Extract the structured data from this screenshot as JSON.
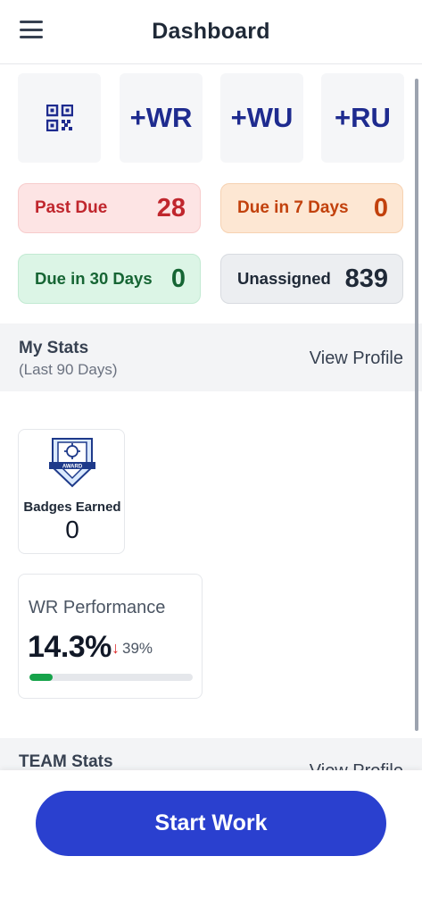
{
  "header": {
    "title": "Dashboard",
    "menu_icon": "hamburger-menu-icon"
  },
  "quick_actions": [
    {
      "icon": "qr-code-icon",
      "label": ""
    },
    {
      "label": "+WR"
    },
    {
      "label": "+WU"
    },
    {
      "label": "+RU"
    }
  ],
  "summary": {
    "past_due": {
      "label": "Past Due",
      "count": "28",
      "color": "#c0262d"
    },
    "due_7": {
      "label": "Due in 7 Days",
      "count": "0",
      "color": "#c2410c"
    },
    "due_30": {
      "label": "Due in 30 Days",
      "count": "0",
      "color": "#166534"
    },
    "unassigned": {
      "label": "Unassigned",
      "count": "839",
      "color": "#1f2937"
    }
  },
  "my_stats": {
    "title": "My Stats",
    "subtitle": "(Last 90 Days)",
    "view_profile": "View Profile",
    "badges": {
      "icon": "award-badge-icon",
      "icon_text": "AWARD",
      "label": "Badges Earned",
      "count": "0"
    },
    "performance": {
      "title": "WR Performance",
      "value": "14.3%",
      "change": "39%",
      "change_direction": "down",
      "progress": 0.143
    }
  },
  "team_stats": {
    "title": "TEAM Stats",
    "view_profile": "View Profile"
  },
  "footer": {
    "start_button": "Start Work",
    "accent_color": "#2a40cf"
  }
}
